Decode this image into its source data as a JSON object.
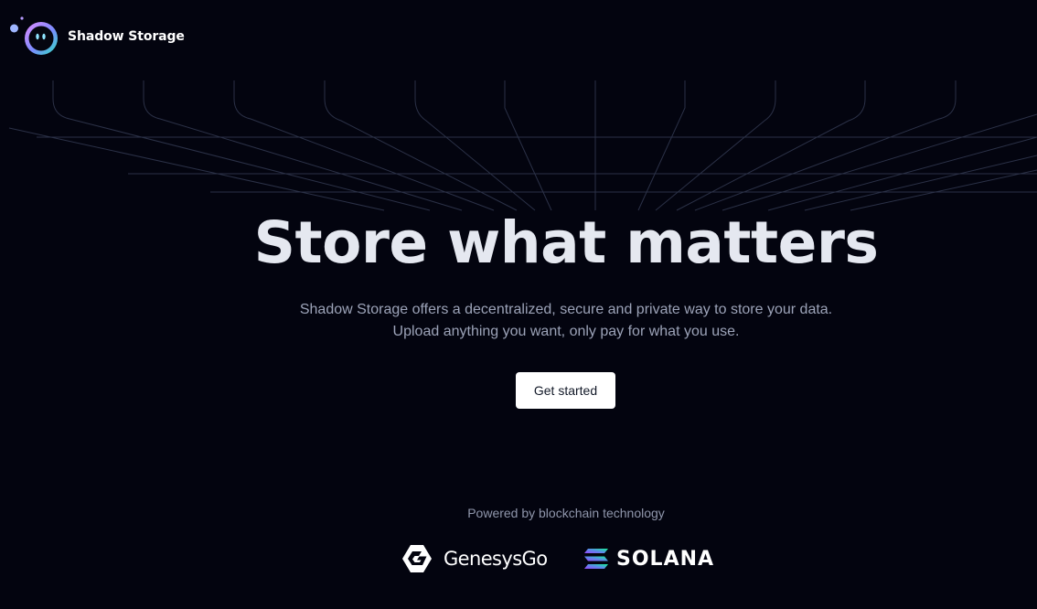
{
  "header": {
    "brand_name": "Shadow Storage",
    "logo_icon": "shadow-storage-logo-icon"
  },
  "hero": {
    "title": "Store what matters",
    "subtitle_line1": "Shadow Storage offers a decentralized, secure and private way to store your data.",
    "subtitle_line2": "Upload anything you want, only pay for what you use.",
    "cta_label": "Get started"
  },
  "footer": {
    "powered_by": "Powered by blockchain technology",
    "partners": [
      {
        "name": "GenesysGo",
        "icon": "genesysgo-logo-icon"
      },
      {
        "name": "SOLANA",
        "icon": "solana-logo-icon"
      }
    ]
  },
  "colors": {
    "background": "#03040f",
    "title": "#e5e8f0",
    "subtitle": "#9ca3b8",
    "button_bg": "#ffffff",
    "grid_lines": "#3a4055"
  }
}
